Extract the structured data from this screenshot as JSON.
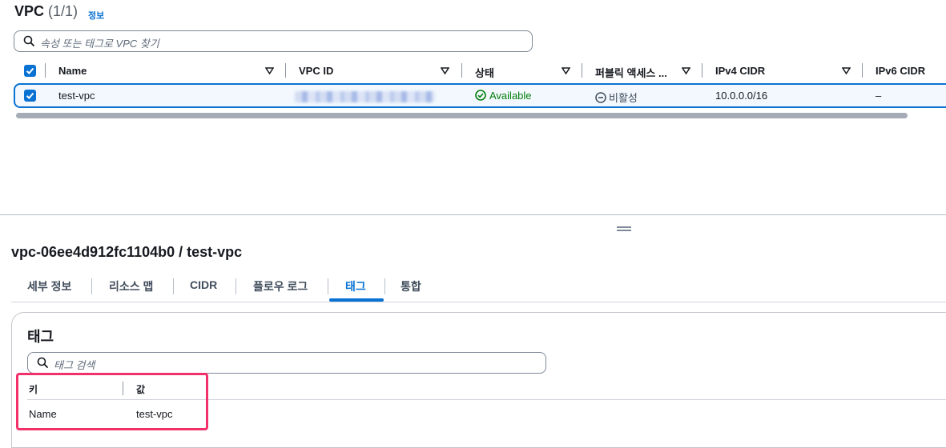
{
  "vpc_panel": {
    "title": "VPC",
    "count": "(1/1)",
    "info_link": "정보",
    "search_placeholder": "속성 또는 태그로 VPC 찾기",
    "columns": [
      "Name",
      "VPC ID",
      "상태",
      "퍼블릭 액세스 ...",
      "IPv4 CIDR",
      "IPv6 CIDR"
    ],
    "row": {
      "name": "test-vpc",
      "status": "Available",
      "public_access": "비활성",
      "ipv4_cidr": "10.0.0.0/16",
      "ipv6_cidr": "–"
    }
  },
  "detail": {
    "title": "vpc-06ee4d912fc1104b0 / test-vpc",
    "tabs": [
      "세부 정보",
      "리소스 맵",
      "CIDR",
      "플로우 로그",
      "태그",
      "통합"
    ],
    "active_tab": "태그"
  },
  "tags": {
    "title": "태그",
    "search_placeholder": "태그 검색",
    "headers": {
      "key": "키",
      "value": "값"
    },
    "rows": [
      {
        "key": "Name",
        "value": "test-vpc"
      }
    ]
  },
  "colors": {
    "accent": "#0972d3",
    "success": "#037f0c",
    "highlight": "#f2316b"
  },
  "icons": [
    "search-icon",
    "checkbox-checked-icon",
    "sort-caret-icon",
    "status-check-icon",
    "status-disabled-icon",
    "resize-grip-icon"
  ]
}
